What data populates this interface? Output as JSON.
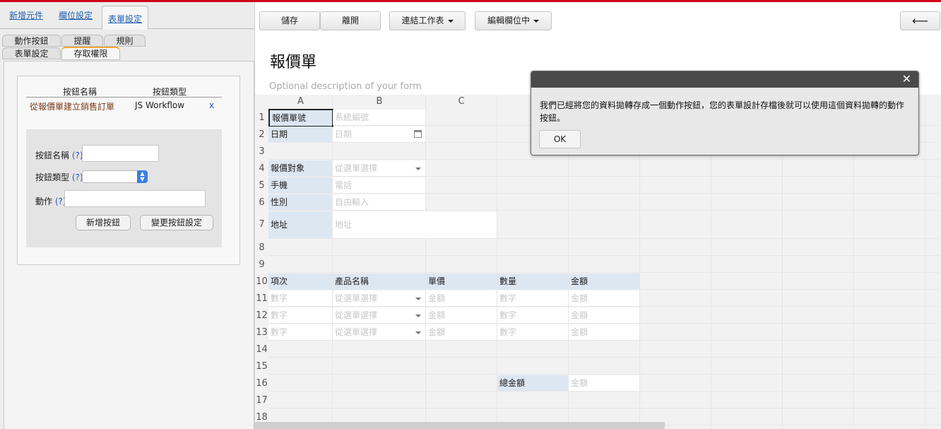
{
  "left_tabs": [
    "新增元件",
    "欄位設定",
    "表單設定"
  ],
  "sub_tabs_row1": [
    "動作按鈕",
    "提醒",
    "規則"
  ],
  "sub_tabs_row2": [
    "表單設定",
    "存取權限"
  ],
  "buttons_table": {
    "headers": [
      "按鈕名稱",
      "按鈕類型"
    ],
    "rows": [
      {
        "name": "從報價單建立銷售訂單",
        "type": "JS Workflow",
        "remove": "x"
      }
    ]
  },
  "button_form": {
    "name_label": "按鈕名稱",
    "type_label": "按鈕類型",
    "action_label": "動作",
    "help": "(?)",
    "add_button": "新增按鈕",
    "change_button": "變更按鈕設定"
  },
  "toolbar": {
    "save": "儲存",
    "leave": "離開",
    "link_sheet": "連結工作表",
    "edit_field": "編輯欄位中",
    "back": "⟵"
  },
  "form": {
    "title": "報價單",
    "description": "Optional description of your form"
  },
  "grid": {
    "columns": [
      "A",
      "B",
      "C"
    ],
    "rows": [
      "1",
      "2",
      "3",
      "4",
      "5",
      "6",
      "7",
      "8",
      "9",
      "10",
      "11",
      "12",
      "13",
      "14",
      "15",
      "16",
      "17",
      "18"
    ],
    "cells": {
      "r1_label": "報價單號",
      "r1_value": "系統編號",
      "r2_label": "日期",
      "r2_value": "日期",
      "r4_label": "報價對象",
      "r4_value": "從選單選擇",
      "r5_label": "手機",
      "r5_value": "電話",
      "r6_label": "性別",
      "r6_value": "自由輸入",
      "r7_label": "地址",
      "r7_value": "地址",
      "h_item": "項次",
      "h_product": "產品名稱",
      "h_price": "單價",
      "h_qty": "數量",
      "h_amount": "金額",
      "line_number": "數字",
      "line_product": "從選單選擇",
      "line_price": "金額",
      "line_qty": "數字",
      "line_amount": "金額",
      "total_label": "總金額",
      "total_value": "金額"
    }
  },
  "dialog": {
    "close": "✕",
    "message": "我們已經將您的資料拋轉存成一個動作按鈕，您的表單設計存檔後就可以使用這個資料拋轉的動作按鈕。",
    "ok": "OK"
  },
  "colors": {
    "accent_red": "#d0021b",
    "label_bg": "#dde7f2",
    "dialog_header": "#4a4a4a"
  }
}
